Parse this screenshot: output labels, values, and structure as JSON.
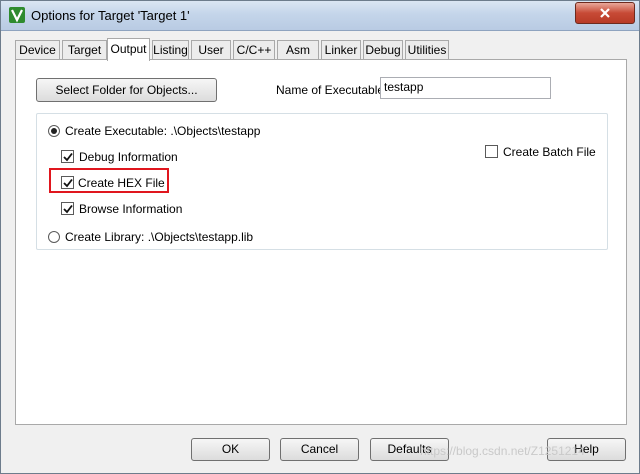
{
  "window": {
    "title": "Options for Target 'Target 1'"
  },
  "tabs": [
    "Device",
    "Target",
    "Output",
    "Listing",
    "User",
    "C/C++",
    "Asm",
    "Linker",
    "Debug",
    "Utilities"
  ],
  "active_tab": "Output",
  "output": {
    "select_folder_label": "Select Folder for Objects...",
    "name_exec_label": "Name of Executable:",
    "name_exec_value": "testapp",
    "create_exec_label": "Create Executable:  .\\Objects\\testapp",
    "create_exec_selected": true,
    "debug_info_label": "Debug Information",
    "debug_info_checked": true,
    "create_hex_label": "Create HEX File",
    "create_hex_checked": true,
    "browse_info_label": "Browse Information",
    "browse_info_checked": true,
    "create_batch_label": "Create Batch File",
    "create_batch_checked": false,
    "create_lib_label": "Create Library:  .\\Objects\\testapp.lib",
    "create_lib_selected": false
  },
  "footer": {
    "ok": "OK",
    "cancel": "Cancel",
    "defaults": "Defaults",
    "help": "Help"
  },
  "watermark": "https://blog.csdn.net/Z1251214",
  "colors": {
    "highlight": "#e0161e",
    "title_bar": "#c4d5ea",
    "close_button": "#c74a36"
  }
}
